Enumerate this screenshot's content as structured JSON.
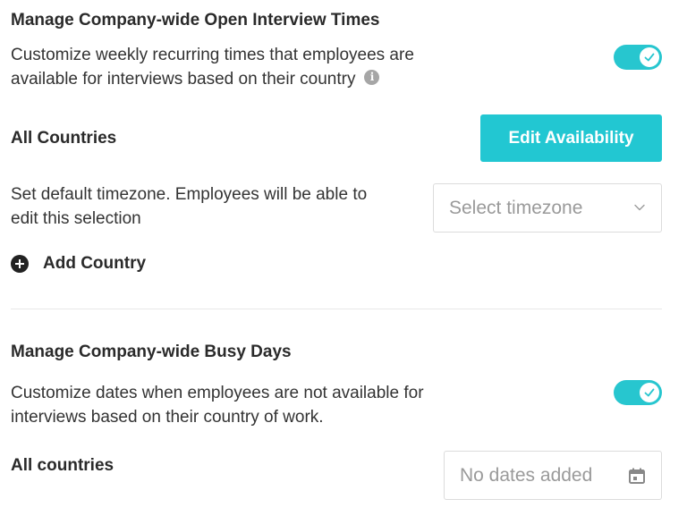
{
  "open_times": {
    "title": "Manage Company-wide Open Interview Times",
    "description_line1": "Customize weekly recurring times that employees are",
    "description_line2": "available for interviews based on their country",
    "toggle_on": true,
    "all_countries_label": "All Countries",
    "edit_button_label": "Edit Availability",
    "timezone_desc_line1": "Set default timezone. Employees will be able to",
    "timezone_desc_line2": "edit this selection",
    "timezone_placeholder": "Select timezone",
    "add_country_label": "Add Country"
  },
  "busy_days": {
    "title": "Manage Company-wide Busy Days",
    "description_line1": "Customize dates when employees are not available for",
    "description_line2": "interviews based on their country of work.",
    "toggle_on": true,
    "all_countries_label": "All countries",
    "dates_placeholder": "No dates added"
  },
  "colors": {
    "accent": "#22c7d2",
    "toggle": "#27c6cf",
    "placeholder_text": "#9a9a9a",
    "border": "#dcdcdc"
  },
  "icons": [
    "info-icon",
    "check-icon",
    "chevron-down-icon",
    "plus-circle-icon",
    "calendar-icon"
  ]
}
